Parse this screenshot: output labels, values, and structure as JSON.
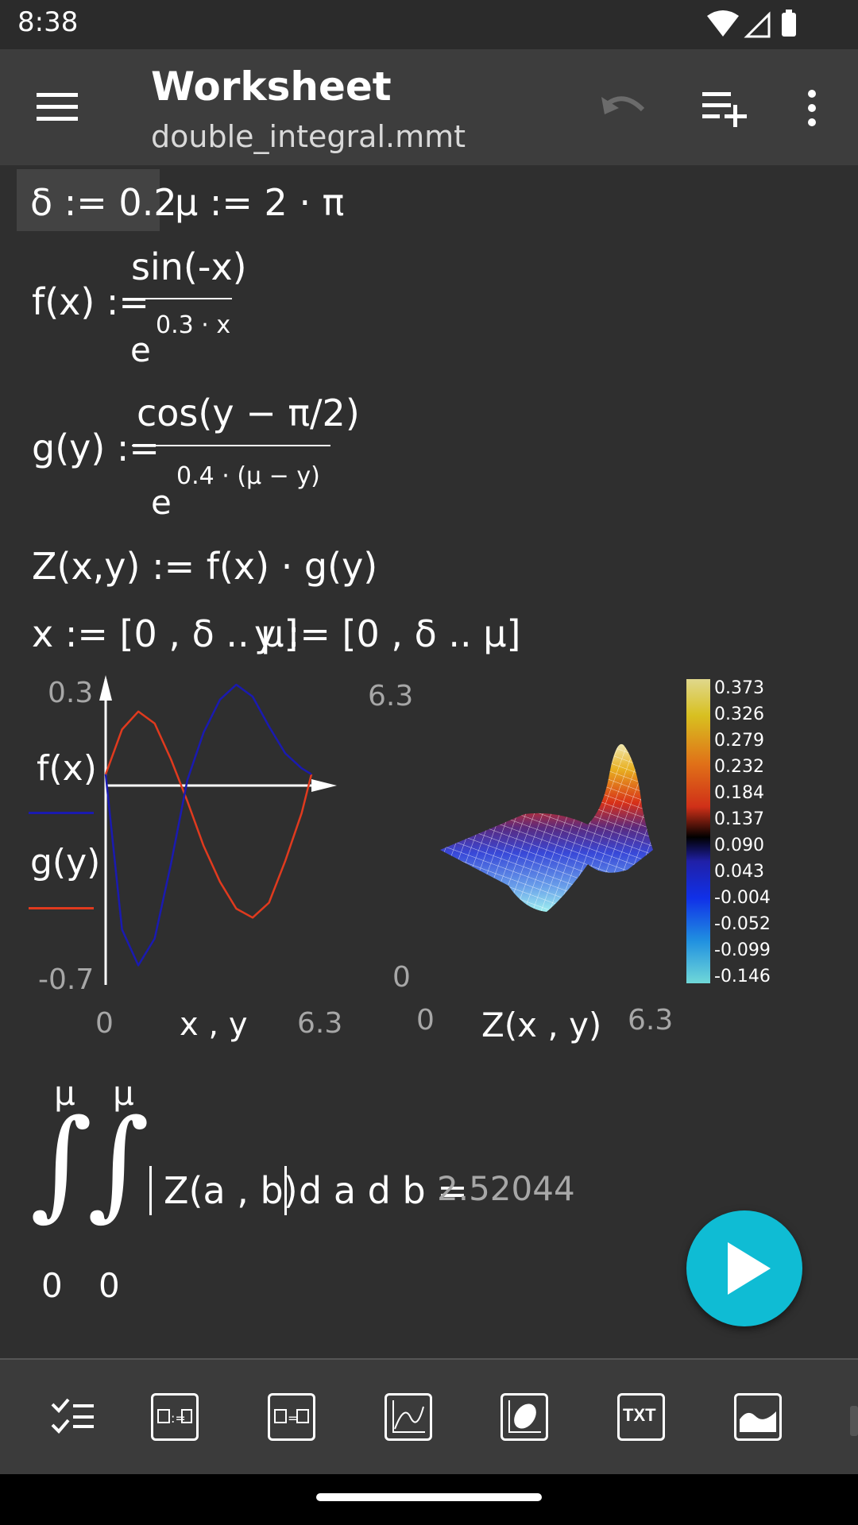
{
  "status_bar": {
    "time": "8:38"
  },
  "app_bar": {
    "title": "Worksheet",
    "subtitle": "double_integral.mmt"
  },
  "worksheet": {
    "line1": {
      "delta_def": "δ := 0.2",
      "mu_def": "μ := 2 · π"
    },
    "f_def": {
      "lhs": "f(x) :=",
      "numerator": "sin(-x)",
      "denominator_base": "e",
      "denominator_exp": "0.3 · x"
    },
    "g_def": {
      "lhs": "g(y) :=",
      "numerator": "cos(y − π/2)",
      "denominator_base": "e",
      "denominator_exp": "0.4 · (μ − y)"
    },
    "z_def": "Z(x,y) := f(x) · g(y)",
    "ranges": {
      "x_range": "x := [0 , δ .. μ]",
      "y_range": "y := [0 , δ .. μ]"
    },
    "plot2d": {
      "y_max": "0.3",
      "y_min": "-0.7",
      "x_min": "0",
      "x_max": "6.3",
      "x_axis_label": "x , y",
      "legend_f": "f(x)",
      "legend_g": "g(y)",
      "colors": {
        "f": "#e03a1e",
        "g": "#1a1ab0"
      }
    },
    "plot3d": {
      "y_top": "6.3",
      "y_bottom": "0",
      "x_min": "0",
      "x_max": "6.3",
      "label": "Z(x , y)",
      "colorbar": [
        "0.373",
        "0.326",
        "0.279",
        "0.232",
        "0.184",
        "0.137",
        "0.090",
        "0.043",
        "-0.004",
        "-0.052",
        "-0.099",
        "-0.146"
      ]
    },
    "integral": {
      "upper1": "μ",
      "lower1": "0",
      "upper2": "μ",
      "lower2": "0",
      "expression": "Z(a , b)",
      "differentials": "d a d b =",
      "result": "2.52044"
    }
  },
  "toolbar": {
    "icons": [
      "checklist-icon",
      "define-icon",
      "equation-icon",
      "plot2d-icon",
      "plot3d-icon",
      "text-icon",
      "image-icon"
    ],
    "text_label": "TXT"
  },
  "chart_data": {
    "type": "line",
    "title": "",
    "xlabel": "x , y",
    "ylabel": "",
    "xlim": [
      0,
      6.3
    ],
    "ylim": [
      -0.7,
      0.3
    ],
    "series": [
      {
        "name": "f(x)",
        "x": [
          0,
          0.5,
          1.0,
          1.5,
          2.0,
          2.5,
          3.0,
          3.5,
          4.0,
          4.5,
          5.0,
          5.5,
          6.0,
          6.3
        ],
        "values": [
          0,
          0.15,
          0.21,
          0.17,
          0.05,
          -0.09,
          -0.24,
          -0.36,
          -0.45,
          -0.48,
          -0.43,
          -0.29,
          -0.13,
          0
        ]
      },
      {
        "name": "g(y)",
        "x": [
          0,
          0.5,
          1.0,
          1.5,
          2.0,
          2.5,
          3.0,
          3.5,
          4.0,
          4.5,
          5.0,
          5.5,
          6.0,
          6.3
        ],
        "values": [
          0,
          -0.52,
          -0.64,
          -0.55,
          -0.3,
          -0.02,
          0.14,
          0.25,
          0.3,
          0.26,
          0.16,
          0.07,
          0.02,
          0
        ]
      }
    ]
  }
}
